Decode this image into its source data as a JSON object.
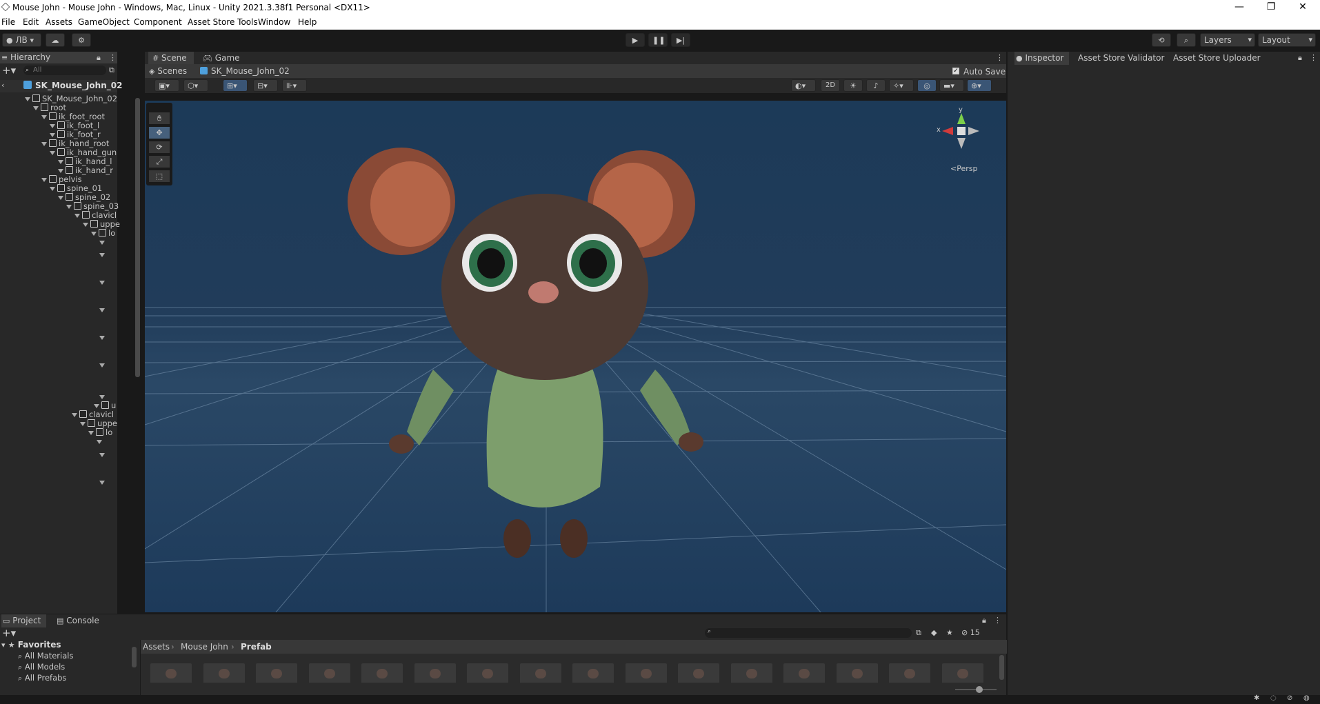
{
  "window": {
    "title": "Mouse John - Mouse John - Windows, Mac, Linux - Unity 2021.3.38f1 Personal <DX11>",
    "minimize": "—",
    "maximize": "❐",
    "close": "✕"
  },
  "menu": [
    "File",
    "Edit",
    "Assets",
    "GameObject",
    "Component",
    "Asset Store Tools",
    "Window",
    "Help"
  ],
  "toolbar": {
    "account_label": "ЛВ",
    "layers_label": "Layers",
    "layout_label": "Layout"
  },
  "hierarchy": {
    "tab_label": "Hierarchy",
    "search_placeholder": "All",
    "scene_root": "SK_Mouse_John_02",
    "items": [
      "SK_Mouse_John_02",
      "root",
      "ik_foot_root",
      "ik_foot_l",
      "ik_foot_r",
      "ik_hand_root",
      "ik_hand_gun",
      "ik_hand_l",
      "ik_hand_r",
      "pelvis",
      "spine_01",
      "spine_02",
      "spine_03",
      "clavicl",
      "uppe",
      "lo",
      "",
      "",
      "",
      "",
      "",
      "",
      "",
      "u",
      "clavicl",
      "uppe",
      "lo",
      "",
      "",
      ""
    ]
  },
  "scene_view": {
    "tab_scene": "Scene",
    "tab_game": "Game",
    "breadcrumb_scenes": "Scenes",
    "breadcrumb_object": "SK_Mouse_John_02",
    "auto_save_label": "Auto Save",
    "auto_save_checked": true,
    "mode_2d": "2D",
    "gizmo_x": "x",
    "gizmo_y": "y",
    "persp_label": "<Persp"
  },
  "inspector": {
    "tabs": [
      "Inspector",
      "Asset Store Validator",
      "Asset Store Uploader"
    ]
  },
  "project": {
    "tab_project": "Project",
    "tab_console": "Console",
    "favorites_label": "Favorites",
    "favorites": [
      "All Materials",
      "All Models",
      "All Prefabs"
    ],
    "breadcrumb": [
      "Assets",
      "Mouse John",
      "Prefab"
    ],
    "hidden_count": "15",
    "thumb_count": 16
  },
  "colors": {
    "accent_blue": "#3a79bb",
    "scene_sky": "#1d3a5a",
    "panel_bg": "#282828"
  }
}
